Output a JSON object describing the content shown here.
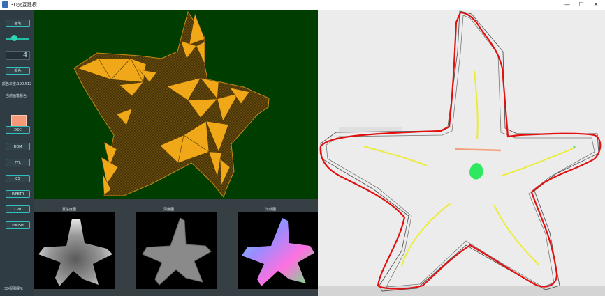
{
  "window": {
    "title": "3D交互建模",
    "minimize": "—",
    "maximize": "☐",
    "close": "✕"
  },
  "sidebar": {
    "brush_button": "画笔",
    "lcd_value": "4",
    "color_button": "颜色",
    "color_value": "颜色灰度:190.512",
    "current_color_label": "当前画笔颜色",
    "swatch_color": "#f59a78",
    "buttons": [
      "DSC",
      "DDM",
      "FFL",
      "CS",
      "INFETR",
      "CPR",
      "FINISH"
    ]
  },
  "status": {
    "text": "3D视图展示"
  },
  "thumbnails": {
    "labels": [
      "置信度图",
      "深度图",
      "法线图"
    ]
  },
  "colors": {
    "accent": "#2ec1c1",
    "mesh_bg": "#003d00",
    "mesh_face": "#f0a818",
    "outline": "#e81010",
    "stroke_yellow": "#ecec38",
    "stroke_green": "#2ee860"
  }
}
